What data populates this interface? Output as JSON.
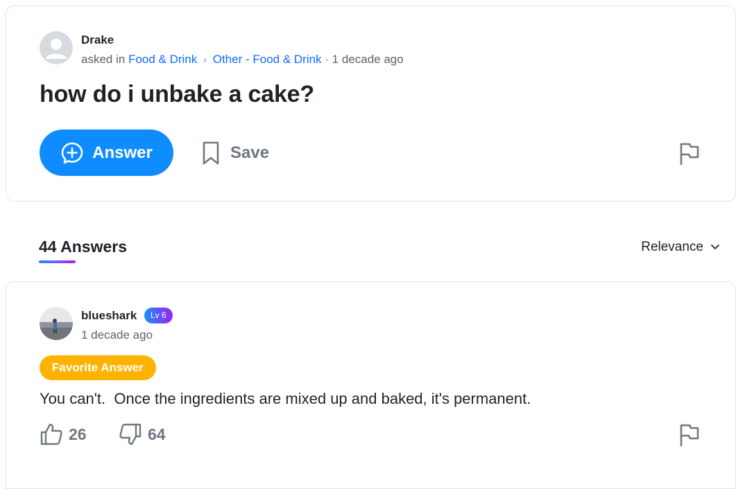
{
  "question": {
    "author": "Drake",
    "asked_in_prefix": "asked in",
    "category": "Food & Drink",
    "subcategory": "Other - Food & Drink",
    "time": "· 1 decade ago",
    "title": "how do i unbake a cake?",
    "answer_button": "Answer",
    "save_button": "Save"
  },
  "answers_section": {
    "count_label": "44 Answers",
    "sort_label": "Relevance"
  },
  "answer": {
    "author": "blueshark",
    "level": "Lv 6",
    "time": "1 decade ago",
    "favorite_label": "Favorite Answer",
    "text": "You can't.  Once the ingredients are mixed up and baked, it's permanent.",
    "thumbs_up": "26",
    "thumbs_down": "64"
  },
  "colors": {
    "accent_blue": "#0f8cff",
    "link_blue": "#0f69ff",
    "favorite_gold": "#ffb300",
    "muted_gray": "#6e7780"
  }
}
